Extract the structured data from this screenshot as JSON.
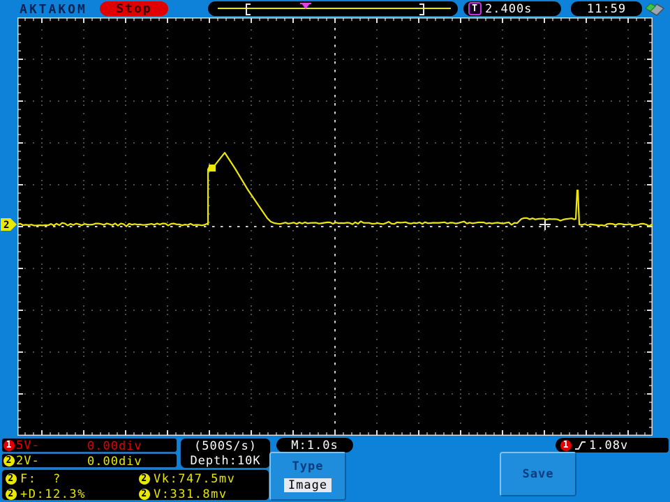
{
  "header": {
    "brand": "AKTAKOM",
    "run_state": "Stop",
    "trigger_symbol": "T",
    "trigger_time": "2.400s",
    "clock": "11:59"
  },
  "channels": {
    "ch1": {
      "num": "1",
      "scale": "5V-",
      "offset": "0.00div",
      "color": "#e10000"
    },
    "ch2": {
      "num": "2",
      "scale": "2V-",
      "offset": "0.00div",
      "color": "#e8e800"
    }
  },
  "acquisition": {
    "sample_rate": "(500S/s)",
    "depth": "Depth:10K",
    "timebase": "M:1.0s"
  },
  "trigger": {
    "ch": "1",
    "level": "1.08v"
  },
  "measurements": [
    {
      "ch": "2",
      "text": "F:  ?"
    },
    {
      "ch": "2",
      "text": "Vk:747.5mv"
    },
    {
      "ch": "2",
      "text": "+D:12.3%"
    },
    {
      "ch": "2",
      "text": "V:331.8mv"
    }
  ],
  "menu": {
    "type_label": "Type",
    "type_value": "Image",
    "save_label": "Save"
  },
  "colors": {
    "bezel_blue": "#0e82d8",
    "screen_black": "#010101",
    "grid_dot": "#8a8a8a",
    "grid_center": "#cfcfcf",
    "grid_edge": "#dde2e6",
    "trace_yellow": "#ece80a",
    "cross_white": "#e8e8e8"
  },
  "waveform": {
    "ch": "2",
    "color": "#ece80a",
    "segments": [
      {
        "pts": [
          [
            0,
            297
          ],
          [
            273,
            297
          ]
        ],
        "noise": 1.6
      },
      {
        "pts": [
          [
            273,
            297
          ],
          [
            273,
            218
          ],
          [
            276,
            212
          ],
          [
            279,
            216
          ],
          [
            282,
            213
          ],
          [
            297,
            194
          ]
        ],
        "noise": 0
      },
      {
        "pts": [
          [
            297,
            194
          ],
          [
            312,
            217
          ],
          [
            330,
            247
          ],
          [
            347,
            272
          ],
          [
            358,
            288
          ],
          [
            363,
            293
          ]
        ],
        "noise": 0
      },
      {
        "pts": [
          [
            363,
            293
          ],
          [
            368,
            295
          ],
          [
            716,
            295
          ]
        ],
        "noise": 1.3
      },
      {
        "pts": [
          [
            716,
            295
          ],
          [
            722,
            289
          ],
          [
            800,
            289
          ]
        ],
        "noise": 1.3
      },
      {
        "pts": [
          [
            800,
            289
          ],
          [
            802,
            248
          ],
          [
            803,
            248
          ],
          [
            805,
            297
          ]
        ],
        "noise": 0
      },
      {
        "pts": [
          [
            805,
            297
          ],
          [
            910,
            297
          ]
        ],
        "noise": 1.3
      }
    ],
    "blob": [
      274,
      211,
      10,
      10
    ],
    "trigger_cross": [
      756,
      297
    ]
  }
}
